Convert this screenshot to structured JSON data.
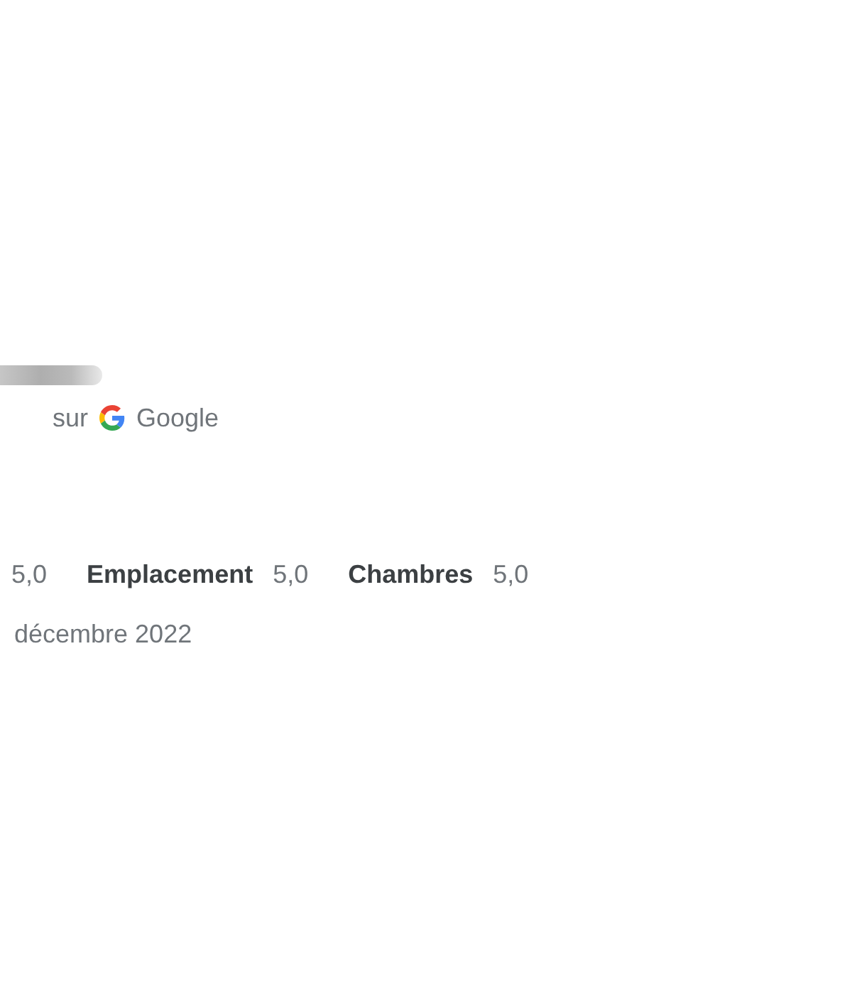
{
  "source": {
    "prefix": "sur",
    "name": "Google"
  },
  "ratings": [
    {
      "value": "5,0"
    },
    {
      "label": "Emplacement",
      "value": "5,0"
    },
    {
      "label": "Chambres",
      "value": "5,0"
    }
  ],
  "date": "décembre 2022"
}
